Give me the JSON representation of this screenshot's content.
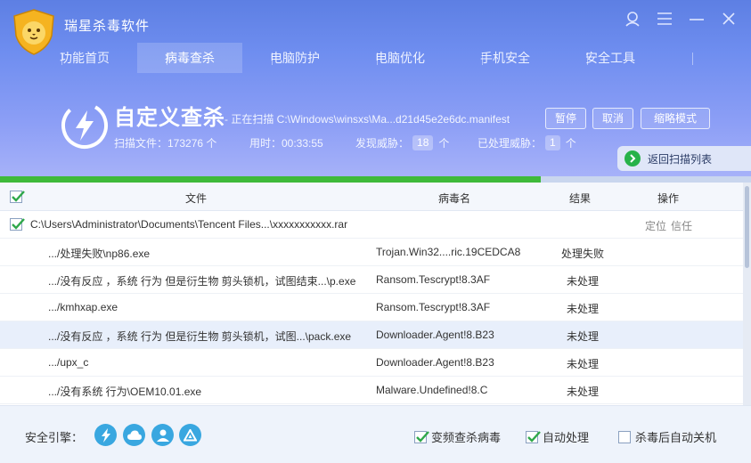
{
  "app": {
    "title": "瑞星杀毒软件"
  },
  "window_controls": [
    {
      "icon": "user-icon"
    },
    {
      "icon": "menu-icon"
    },
    {
      "icon": "minimize-icon"
    },
    {
      "icon": "close-icon"
    }
  ],
  "nav": {
    "tabs": [
      {
        "label": "功能首页"
      },
      {
        "label": "病毒查杀",
        "active": true
      },
      {
        "label": "电脑防护"
      },
      {
        "label": "电脑优化"
      },
      {
        "label": "手机安全"
      },
      {
        "label": "安全工具"
      }
    ]
  },
  "scan": {
    "title": "自定义查杀",
    "status": "- 正在扫描 C:\\Windows\\winsxs\\Ma...d21d45e2e6dc.manifest",
    "pause_label": "暂停",
    "cancel_label": "取消",
    "mini_label": "缩略模式",
    "files_label": "扫描文件：173276 个",
    "time_label": "用时：00:33:55",
    "threats_label": "发现威胁：",
    "threats_count": "18",
    "handled_label": "已处理威胁：",
    "handled_count": "1",
    "unit": "个",
    "progress_percent": 72
  },
  "return_list_label": "返回扫描列表",
  "table": {
    "headers": {
      "file": "文件",
      "virus": "病毒名",
      "result": "结果",
      "action": "操作"
    },
    "group": {
      "path": "C:\\Users\\Administrator\\Documents\\Tencent Files...\\xxxxxxxxxxx.rar",
      "locate": "定位",
      "trust": "信任"
    },
    "rows": [
      {
        "file": ".../处理失败\\np86.exe",
        "virus": "Trojan.Win32....ric.19CEDCA8",
        "result": "处理失败"
      },
      {
        "file": ".../没有反应 ，系统  行为  但是衍生物 剪头锁机，试图结束...\\p.exe",
        "virus": "Ransom.Tescrypt!8.3AF",
        "result": "未处理"
      },
      {
        "file": ".../kmhxap.exe",
        "virus": "Ransom.Tescrypt!8.3AF",
        "result": "未处理"
      },
      {
        "file": ".../没有反应 ，系统  行为  但是衍生物 剪头锁机，试图...\\pack.exe",
        "virus": "Downloader.Agent!8.B23",
        "result": "未处理",
        "selected": true
      },
      {
        "file": ".../upx_c",
        "virus": "Downloader.Agent!8.B23",
        "result": "未处理"
      },
      {
        "file": ".../没有系统  行为\\OEM10.01.exe",
        "virus": "Malware.Undefined!8.C",
        "result": "未处理"
      }
    ]
  },
  "footer": {
    "engine_label": "安全引擎：",
    "engines": [
      {
        "icon": "lightning-icon"
      },
      {
        "icon": "cloud-icon"
      },
      {
        "icon": "person-icon"
      },
      {
        "icon": "recycle-icon"
      }
    ],
    "options": [
      {
        "label": "变频查杀病毒",
        "checked": true
      },
      {
        "label": "自动处理",
        "checked": true
      },
      {
        "label": "杀毒后自动关机",
        "checked": false
      }
    ]
  },
  "colors": {
    "header": "#6f8ef0",
    "progress": "#3fba3a",
    "engine": "#39a7e0",
    "check": "#2fa84a"
  }
}
